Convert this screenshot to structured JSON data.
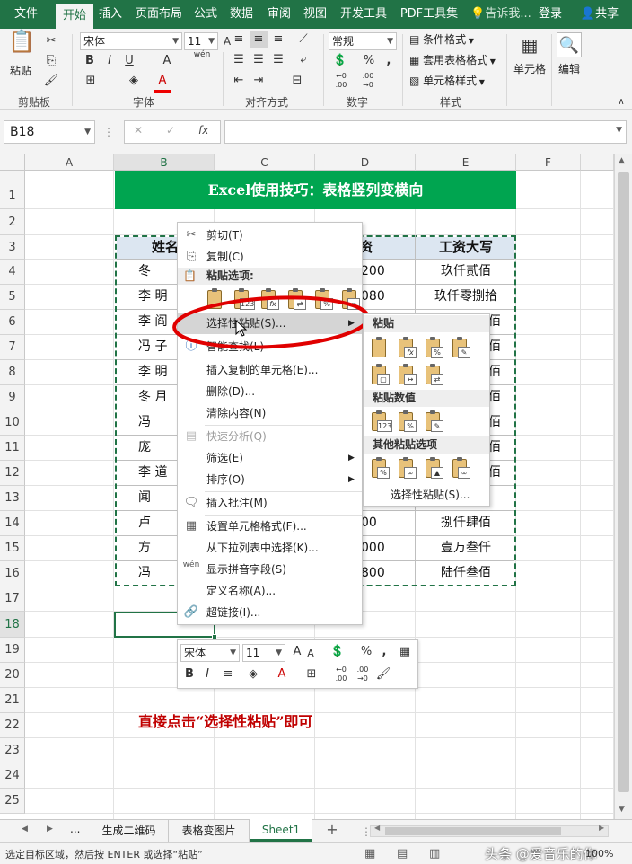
{
  "ribbon": {
    "tabs": [
      "文件",
      "开始",
      "插入",
      "页面布局",
      "公式",
      "数据",
      "审阅",
      "视图",
      "开发工具",
      "PDF工具集"
    ],
    "active_tab": "开始",
    "tell_me": "告诉我...",
    "login": "登录",
    "share": "共享",
    "clipboard": {
      "paste": "粘贴",
      "label": "剪贴板"
    },
    "font": {
      "name": "宋体",
      "size": "11",
      "label": "字体",
      "bold": "B",
      "italic": "I",
      "underline": "U",
      "grow": "A",
      "shrink": "A",
      "color_a": "A",
      "wen": "wén"
    },
    "align": {
      "label": "对齐方式"
    },
    "number": {
      "format": "常规",
      "label": "数字",
      "percent": "%",
      "comma": ",",
      "inc": "←0 .00",
      "dec": ".00 →0"
    },
    "styles": {
      "cond": "条件格式",
      "table": "套用表格格式",
      "cell": "单元格样式",
      "label": "样式"
    },
    "cells": {
      "label": "单元格"
    },
    "editing": {
      "label": "编辑"
    }
  },
  "formula_bar": {
    "name_box": "B18",
    "fx": "fx",
    "cancel": "✕",
    "enter": "✓"
  },
  "grid": {
    "columns": [
      "A",
      "B",
      "C",
      "D",
      "E",
      "F"
    ],
    "rows": [
      "1",
      "2",
      "3",
      "4",
      "5",
      "6",
      "7",
      "8",
      "9",
      "10",
      "11",
      "12",
      "13",
      "14",
      "15",
      "16",
      "17",
      "18",
      "19",
      "20",
      "21",
      "22",
      "23",
      "24",
      "25"
    ],
    "title": "Excel使用技巧：表格竖列变横向",
    "header_b": "姓名",
    "header_d": "资",
    "header_e": "工资大写",
    "names": [
      "冬",
      "李 明",
      "李 阎",
      "冯 子",
      "李 明",
      "冬 月",
      "冯",
      "庞",
      "李 道",
      "闻",
      "卢",
      "方",
      "冯"
    ],
    "d_values": [
      "200",
      "080",
      "",
      "",
      "",
      "",
      "",
      "",
      "",
      "",
      "00",
      "000",
      "800"
    ],
    "e_values": [
      "玖仟贰佰",
      "玖仟零捌拾",
      "佰",
      "佰",
      "佰",
      "佰",
      "佰",
      "佰",
      "佰",
      "",
      "捌仟肆佰",
      "壹万叁仟",
      "陆仟叁佰"
    ],
    "note": "直接点击“选择性粘贴”即可"
  },
  "context_menu": {
    "cut": "剪切(T)",
    "copy": "复制(C)",
    "paste_options": "粘贴选项:",
    "paste_special": "选择性粘贴(S)...",
    "smart_lookup": "智能查找(L)",
    "insert_copied": "插入复制的单元格(E)...",
    "delete": "删除(D)...",
    "clear": "清除内容(N)",
    "quick_analysis": "快速分析(Q)",
    "filter": "筛选(E)",
    "sort": "排序(O)",
    "insert_comment": "插入批注(M)",
    "format_cells": "设置单元格格式(F)...",
    "pick_list": "从下拉列表中选择(K)...",
    "phonetic": "显示拼音字段(S)",
    "define_name": "定义名称(A)...",
    "hyperlink": "超链接(I)..."
  },
  "submenu": {
    "paste": "粘贴",
    "paste_values": "粘贴数值",
    "other": "其他粘贴选项",
    "paste_special": "选择性粘贴(S)..."
  },
  "mini_toolbar": {
    "font": "宋体",
    "size": "11",
    "bold": "B",
    "italic": "I",
    "percent": "%",
    "comma": ","
  },
  "sheets": {
    "ellipsis": "...",
    "tabs": [
      "生成二维码",
      "表格变图片",
      "Sheet1"
    ],
    "active": "Sheet1",
    "add": "+"
  },
  "status": {
    "text": "选定目标区域，然后按 ENTER 或选择“粘贴”",
    "zoom": "100%",
    "watermark": "头条 @爱音乐的你"
  },
  "colors": {
    "excel_green": "#217346",
    "title_fill": "#00a550",
    "header_fill": "#dce6f1",
    "annotation_red": "#e00000",
    "note_red": "#c00000"
  }
}
